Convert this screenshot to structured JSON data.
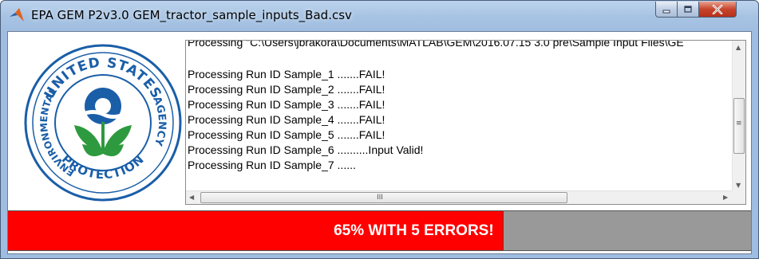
{
  "window": {
    "title": "EPA GEM P2v3.0 GEM_tractor_sample_inputs_Bad.csv",
    "controls": {
      "minimize": "minimize",
      "maximize": "maximize",
      "close": "close"
    }
  },
  "logo": {
    "top_text": "UNITED STATES",
    "left_text": "ENVIRONMENTAL",
    "bottom_text": "PROTECTION",
    "right_text": "AGENCY"
  },
  "log": {
    "lines": [
      "Processing \"C:\\Users\\jbrakora\\Documents\\MATLAB\\GEM\\2016.07.15 3.0 pre\\Sample Input Files\\GE",
      "",
      "Processing Run ID Sample_1 .......FAIL!",
      "Processing Run ID Sample_2 .......FAIL!",
      "Processing Run ID Sample_3 .......FAIL!",
      "Processing Run ID Sample_4 .......FAIL!",
      "Processing Run ID Sample_5 .......FAIL!",
      "Processing Run ID Sample_6 ..........Input Valid!",
      "Processing Run ID Sample_7 ......"
    ],
    "hscroll_grip": "III",
    "vscroll_grip": "≡"
  },
  "progress": {
    "label": "65% WITH 5 ERRORS!",
    "fraction": 0.6667,
    "fill_color": "#ff0000",
    "track_color": "#999999",
    "text_color": "#ffffff"
  },
  "colors": {
    "title_bar": "#a7c3e3",
    "close_button": "#c7452c"
  }
}
